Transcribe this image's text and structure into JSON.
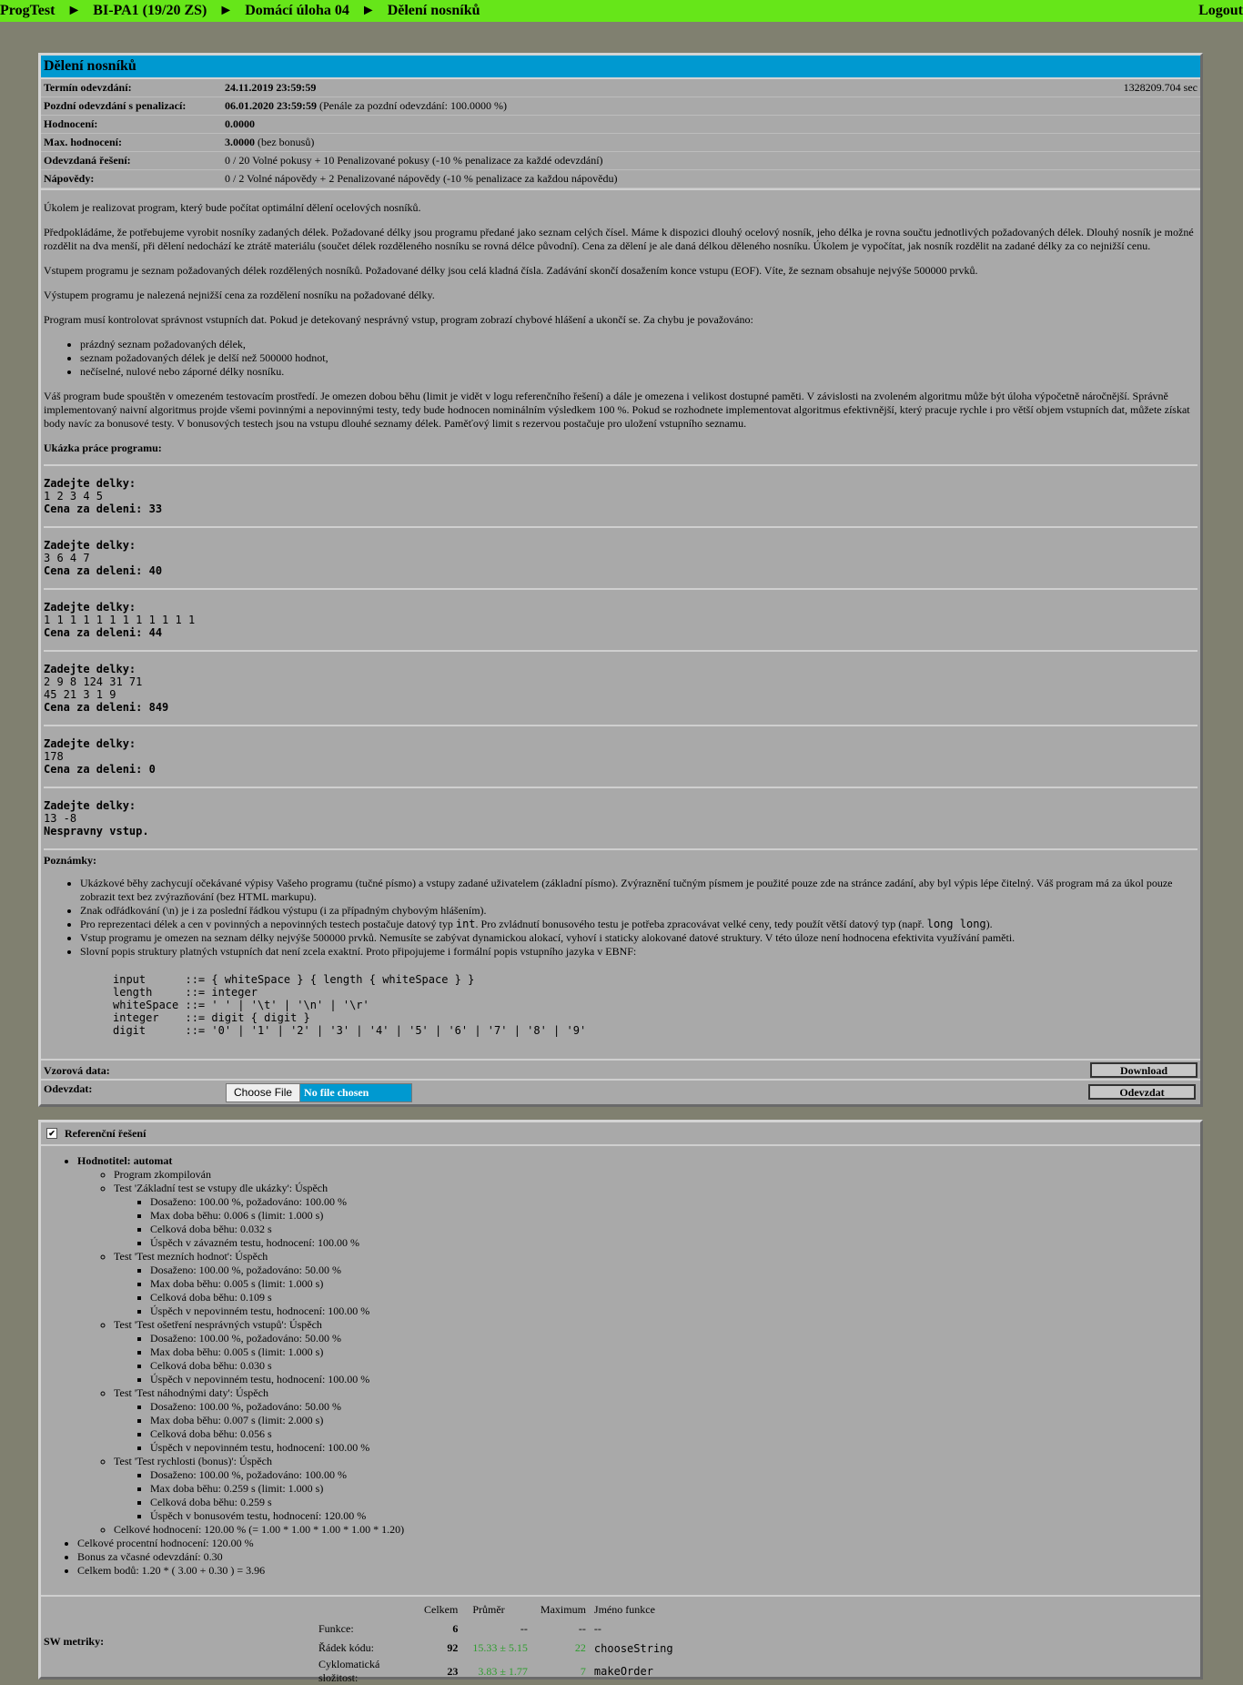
{
  "nav": {
    "breadcrumbs": [
      "ProgTest",
      "BI-PA1 (19/20 ZS)",
      "Domácí úloha 04",
      "Dělení nosníků"
    ],
    "separator": "►",
    "logout": "Logout"
  },
  "task": {
    "title": "Dělení nosníků",
    "info": [
      {
        "label": "Termín odevzdání:",
        "value": "24.11.2019 23:59:59",
        "extra": "",
        "right": "1328209.704 sec"
      },
      {
        "label": "Pozdní odevzdání s penalizací:",
        "value": "06.01.2020 23:59:59",
        "extra": "(Penále za pozdní odevzdání: 100.0000 %)",
        "right": ""
      },
      {
        "label": "Hodnocení:",
        "value": "0.0000",
        "extra": "",
        "right": ""
      },
      {
        "label": "Max. hodnocení:",
        "value": "3.0000",
        "extra": "(bez bonusů)",
        "right": ""
      },
      {
        "label": "Odevzdaná řešení:",
        "value": "",
        "extra": "0 / 20 Volné pokusy + 10 Penalizované pokusy (-10 % penalizace za každé odevzdání)",
        "right": ""
      },
      {
        "label": "Nápovědy:",
        "value": "",
        "extra": "0 / 2 Volné nápovědy + 2 Penalizované nápovědy (-10 % penalizace za každou nápovědu)",
        "right": ""
      }
    ],
    "paragraphs": [
      "Úkolem je realizovat program, který bude počítat optimální dělení ocelových nosníků.",
      "Předpokládáme, že potřebujeme vyrobit nosníky zadaných délek. Požadované délky jsou programu předané jako seznam celých čísel. Máme k dispozici dlouhý ocelový nosník, jeho délka je rovna součtu jednotlivých požadovaných délek. Dlouhý nosník je možné rozdělit na dva menší, při dělení nedochází ke ztrátě materiálu (součet délek rozděleného nosníku se rovná délce původní). Cena za dělení je ale daná délkou děleného nosníku. Úkolem je vypočítat, jak nosník rozdělit na zadané délky za co nejnižší cenu.",
      "Vstupem programu je seznam požadovaných délek rozdělených nosníků. Požadované délky jsou celá kladná čísla. Zadávání skončí dosažením konce vstupu (EOF). Víte, že seznam obsahuje nejvýše 500000 prvků.",
      "Výstupem programu je nalezená nejnižší cena za rozdělení nosníku na požadované délky.",
      "Program musí kontrolovat správnost vstupních dat. Pokud je detekovaný nesprávný vstup, program zobrazí chybové hlášení a ukončí se. Za chybu je považováno:"
    ],
    "errors": [
      "prázdný seznam požadovaných délek,",
      "seznam požadovaných délek je delší než 500000 hodnot,",
      "nečíselné, nulové nebo záporné délky nosníku."
    ],
    "paragraph_env": "Váš program bude spouštěn v omezeném testovacím prostředí. Je omezen dobou běhu (limit je vidět v logu referenčního řešení) a dále je omezena i velikost dostupné paměti. V závislosti na zvoleném algoritmu může být úloha výpočetně náročnější. Správně implementovaný naivní algoritmus projde všemi povinnými a nepovinnými testy, tedy bude hodnocen nominálním výsledkem 100 %. Pokud se rozhodnete implementovat algoritmus efektivnější, který pracuje rychle i pro větší objem vstupních dat, můžete získat body navíc za bonusové testy. V bonusových testech jsou na vstupu dlouhé seznamy délek. Paměťový limit s rezervou postačuje pro uložení vstupního seznamu.",
    "examples_heading": "Ukázka práce programu:",
    "examples": [
      {
        "prompt": "Zadejte delky:",
        "input": "1 2 3 4 5",
        "output": "Cena za deleni: 33"
      },
      {
        "prompt": "Zadejte delky:",
        "input": "3 6 4 7",
        "output": "Cena za deleni: 40"
      },
      {
        "prompt": "Zadejte delky:",
        "input": "1 1 1 1 1 1 1 1 1 1 1 1",
        "output": "Cena za deleni: 44"
      },
      {
        "prompt": "Zadejte delky:",
        "input": "2 9 8 124 31 71\n45 21 3 1 9",
        "output": "Cena za deleni: 849"
      },
      {
        "prompt": "Zadejte delky:",
        "input": "178",
        "output": "Cena za deleni: 0"
      },
      {
        "prompt": "Zadejte delky:",
        "input": "13 -8",
        "output": "Nespravny vstup."
      }
    ],
    "notes_heading": "Poznámky:",
    "notes": [
      "Ukázkové běhy zachycují očekávané výpisy Vašeho programu (tučné písmo) a vstupy zadané uživatelem (základní písmo). Zvýraznění tučným písmem je použité pouze zde na stránce zadání, aby byl výpis lépe čitelný. Váš program má za úkol pouze zobrazit text bez zvýrazňování (bez HTML markupu).",
      "Znak odřádkování (\\n) je i za poslední řádkou výstupu (i za případným chybovým hlášením).",
      "Vstup programu je omezen na seznam délky nejvýše 500000 prvků. Nemusíte se zabývat dynamickou alokací, vyhoví i staticky alokované datové struktury. V této úloze není hodnocena efektivita využívání paměti.",
      "Slovní popis struktury platných vstupních dat není zcela exaktní. Proto připojujeme i formální popis vstupního jazyka v EBNF:"
    ],
    "note_types": {
      "pre": "Pro reprezentaci délek a cen v povinných a nepovinných testech postačuje datový typ ",
      "type1": "int",
      "mid": ". Pro zvládnutí bonusového testu je potřeba zpracovávat velké ceny, tedy použít větší datový typ (např. ",
      "type2": "long long",
      "post": ")."
    },
    "ebnf": "input      ::= { whiteSpace } { length { whiteSpace } }\nlength     ::= integer\nwhiteSpace ::= ' ' | '\\t' | '\\n' | '\\r'\ninteger    ::= digit { digit }\ndigit      ::= '0' | '1' | '2' | '3' | '4' | '5' | '6' | '7' | '8' | '9'",
    "sample_label": "Vzorová data:",
    "download": "Download",
    "submit_label": "Odevzdat:",
    "choose_file": "Choose File",
    "no_file": "No file chosen",
    "submit_button": "Odevzdat"
  },
  "ref": {
    "title": "Referenční řešení",
    "evaluator": "Hodnotitel: automat",
    "compiled": "Program zkompilován",
    "tests": [
      {
        "name": "Test 'Základní test se vstupy dle ukázky': Úspěch",
        "lines": [
          "Dosaženo: 100.00 %, požadováno: 100.00 %",
          "Max doba běhu: 0.006 s (limit: 1.000 s)",
          "Celková doba běhu: 0.032 s",
          "Úspěch v závazném testu, hodnocení: 100.00 %"
        ]
      },
      {
        "name": "Test 'Test mezních hodnot': Úspěch",
        "lines": [
          "Dosaženo: 100.00 %, požadováno: 50.00 %",
          "Max doba běhu: 0.005 s (limit: 1.000 s)",
          "Celková doba běhu: 0.109 s",
          "Úspěch v nepovinném testu, hodnocení: 100.00 %"
        ]
      },
      {
        "name": "Test 'Test ošetření nesprávných vstupů': Úspěch",
        "lines": [
          "Dosaženo: 100.00 %, požadováno: 50.00 %",
          "Max doba běhu: 0.005 s (limit: 1.000 s)",
          "Celková doba běhu: 0.030 s",
          "Úspěch v nepovinném testu, hodnocení: 100.00 %"
        ]
      },
      {
        "name": "Test 'Test náhodnými daty': Úspěch",
        "lines": [
          "Dosaženo: 100.00 %, požadováno: 50.00 %",
          "Max doba běhu: 0.007 s (limit: 2.000 s)",
          "Celková doba běhu: 0.056 s",
          "Úspěch v nepovinném testu, hodnocení: 100.00 %"
        ]
      },
      {
        "name": "Test 'Test rychlosti (bonus)': Úspěch",
        "lines": [
          "Dosaženo: 100.00 %, požadováno: 100.00 %",
          "Max doba běhu: 0.259 s (limit: 1.000 s)",
          "Celková doba běhu: 0.259 s",
          "Úspěch v bonusovém testu, hodnocení: 120.00 %"
        ]
      }
    ],
    "total": "Celkové hodnocení: 120.00 % (= 1.00 * 1.00 * 1.00 * 1.00 * 1.20)",
    "summary": [
      "Celkové procentní hodnocení: 120.00 %",
      "Bonus za včasné odevzdání: 0.30",
      "Celkem bodů: 1.20 * ( 3.00 + 0.30 ) = 3.96"
    ],
    "metrics": {
      "label": "SW metriky:",
      "headers": [
        "",
        "Celkem",
        "Průměr",
        "Maximum",
        "Jméno funkce"
      ],
      "rows": [
        {
          "name": "Funkce:",
          "total": "6",
          "avg": "--",
          "max": "--",
          "fn": "--"
        },
        {
          "name": "Řádek kódu:",
          "total": "92",
          "avg": "15.33 ± 5.15",
          "max": "22",
          "fn": "chooseString"
        },
        {
          "name": "Cyklomatická složitost:",
          "total": "23",
          "avg": "3.83 ± 1.77",
          "max": "7",
          "fn": "makeOrder"
        }
      ]
    }
  }
}
